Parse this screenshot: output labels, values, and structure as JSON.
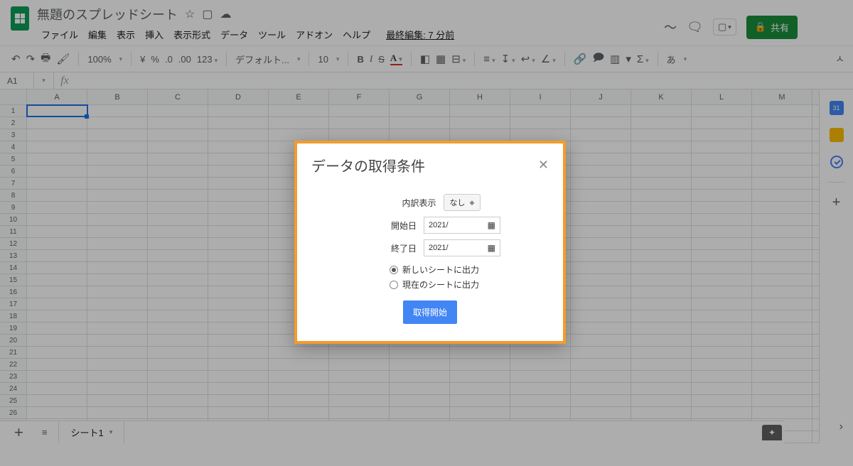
{
  "header": {
    "doc_title": "無題のスプレッドシート",
    "menus": [
      "ファイル",
      "編集",
      "表示",
      "挿入",
      "表示形式",
      "データ",
      "ツール",
      "アドオン",
      "ヘルプ"
    ],
    "last_edit": "最終編集: 7 分前",
    "share_label": "共有"
  },
  "toolbar": {
    "zoom": "100%",
    "currency": "¥",
    "percent": "%",
    "dec_dec": ".0",
    "dec_inc": ".00",
    "num_fmt": "123",
    "font": "デフォルト...",
    "font_size": "10",
    "input_lang": "あ"
  },
  "formula_bar": {
    "cell_ref": "A1",
    "fx": "fx"
  },
  "grid": {
    "columns": [
      "A",
      "B",
      "C",
      "D",
      "E",
      "F",
      "G",
      "H",
      "I",
      "J",
      "K",
      "L",
      "M"
    ],
    "row_count": 28,
    "active_cell": "A1"
  },
  "sheet_tabs": {
    "tab1": "シート1"
  },
  "side_panel": {
    "cal": "31"
  },
  "dialog": {
    "title": "データの取得条件",
    "breakdown_label": "内訳表示",
    "breakdown_value": "なし",
    "start_label": "開始日",
    "start_value": "2021/",
    "end_label": "終了日",
    "end_value": "2021/",
    "radio_new": "新しいシートに出力",
    "radio_cur": "現在のシートに出力",
    "submit": "取得開始"
  }
}
